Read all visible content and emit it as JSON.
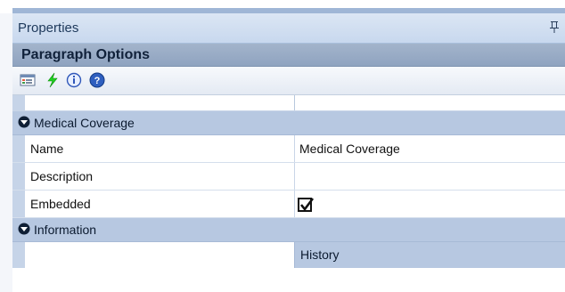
{
  "window": {
    "title": "Properties",
    "pin_icon": "pin-icon"
  },
  "object_header": {
    "label": "Paragraph Options"
  },
  "toolbar": {
    "buttons": [
      {
        "icon": "properties-icon"
      },
      {
        "icon": "events-lightning-icon"
      },
      {
        "icon": "info-icon"
      },
      {
        "icon": "help-icon"
      }
    ]
  },
  "grid": {
    "categories": [
      {
        "label": "Medical Coverage",
        "expanded": true,
        "rows": [
          {
            "name": "Name",
            "value": "Medical Coverage"
          },
          {
            "name": "Description",
            "value": ""
          },
          {
            "name": "Embedded",
            "value": "checked"
          }
        ]
      },
      {
        "label": "Information",
        "expanded": true,
        "rows": [
          {
            "name": "",
            "value": "History"
          }
        ]
      }
    ]
  },
  "colors": {
    "title_bg": "#c8d8ee",
    "object_header_bg": "#8fa3c0",
    "category_bg": "#b7c8e1",
    "row_margin": "#c6d4e8"
  }
}
